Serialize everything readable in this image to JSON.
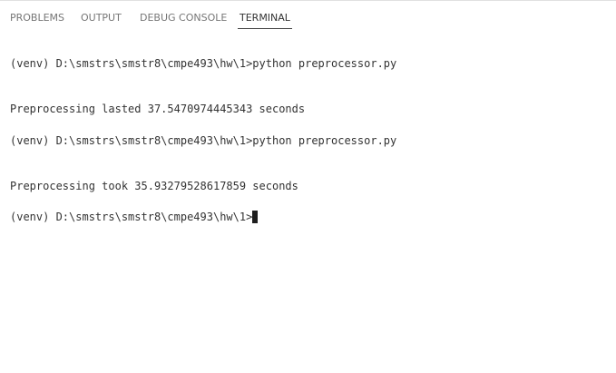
{
  "tabs": [
    {
      "label": "PROBLEMS"
    },
    {
      "label": "OUTPUT"
    },
    {
      "label": "DEBUG CONSOLE"
    },
    {
      "label": "TERMINAL"
    }
  ],
  "active_tab": "TERMINAL",
  "terminal": {
    "lines": [
      "(venv) D:\\smstrs\\smstr8\\cmpe493\\hw\\1>python preprocessor.py",
      "Preprocessing lasted 37.5470974445343 seconds",
      "(venv) D:\\smstrs\\smstr8\\cmpe493\\hw\\1>python preprocessor.py",
      "Preprocessing took 35.93279528617859 seconds",
      "(venv) D:\\smstrs\\smstr8\\cmpe493\\hw\\1>"
    ]
  },
  "colors": {
    "active_tab_text": "#333333",
    "inactive_tab_text": "#767676",
    "terminal_text": "#333333",
    "cursor": "#1e1e1e"
  },
  "icons": {
    "cursor": "terminal-cursor-block"
  }
}
